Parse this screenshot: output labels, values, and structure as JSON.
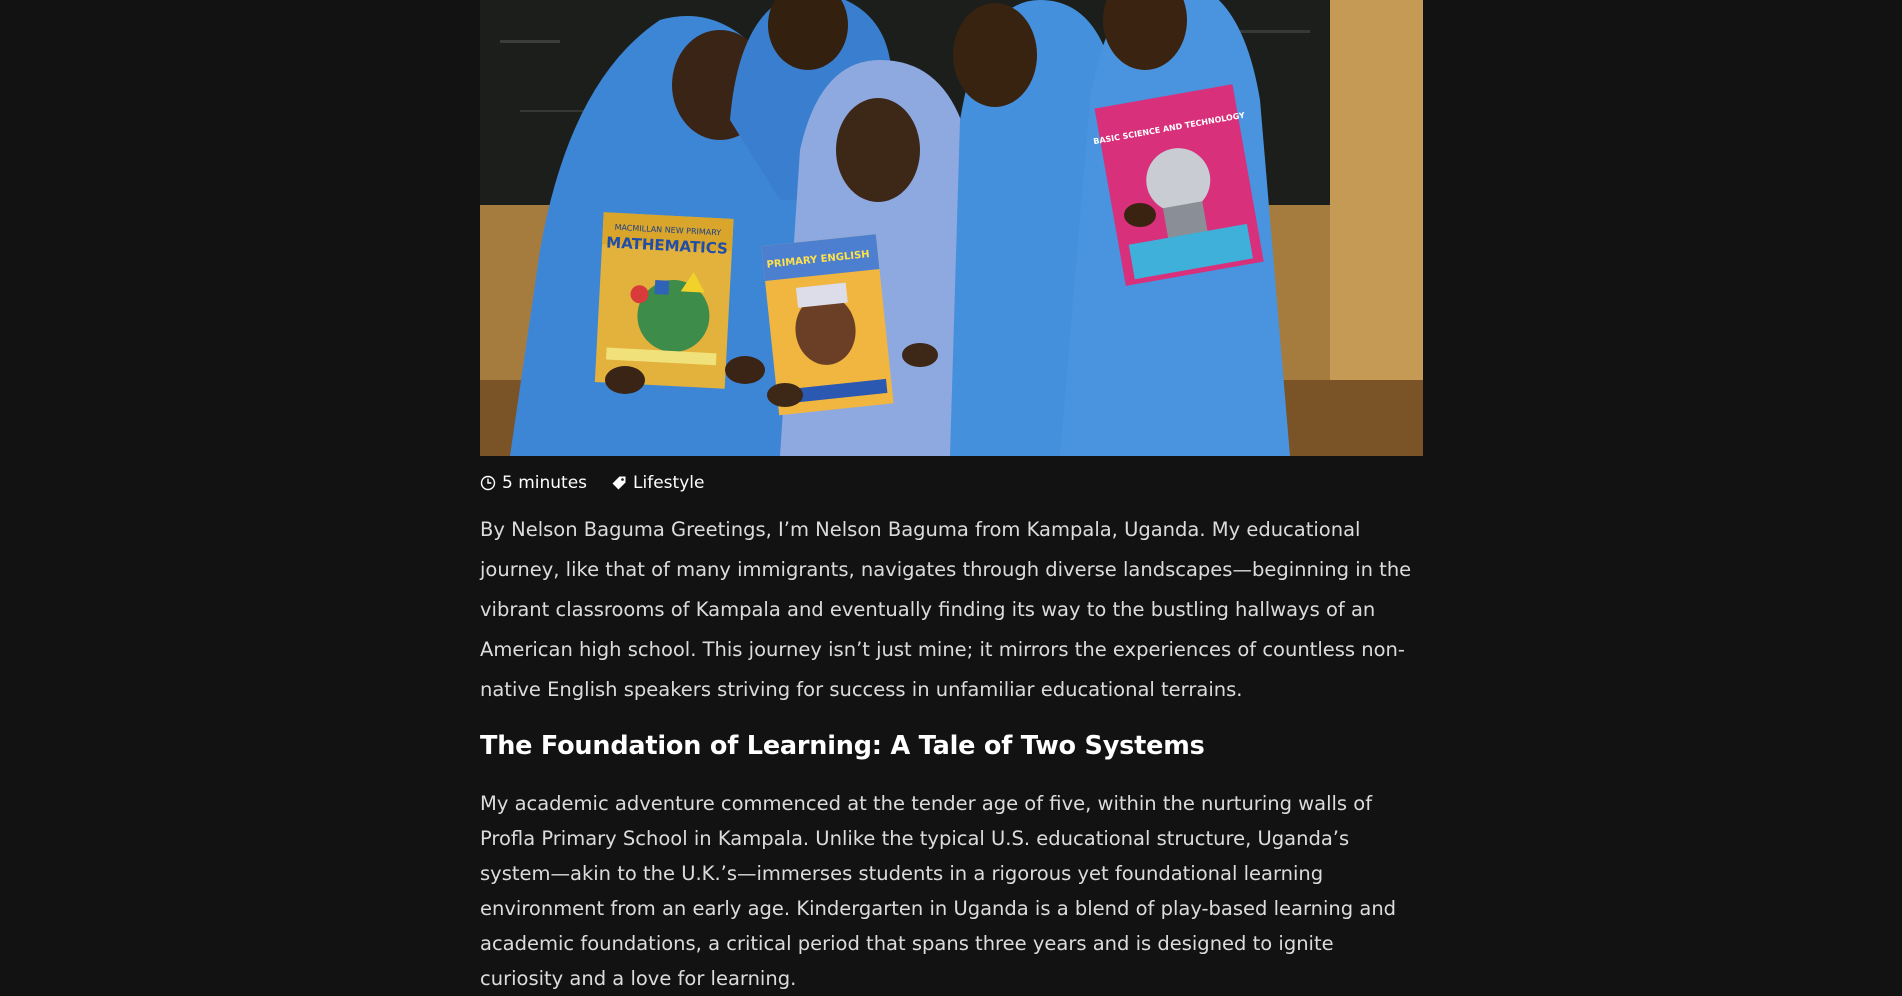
{
  "hero": {
    "book_titles": [
      "MACMILLAN NEW PRIMARY",
      "MATHEMATICS",
      "PRIMARY ENGLISH",
      "BASIC SCIENCE AND TECHNOLOGY"
    ]
  },
  "meta": {
    "read_time": "5 minutes",
    "category": "Lifestyle",
    "read_time_icon": "clock-icon",
    "category_icon": "tag-icon"
  },
  "article": {
    "intro": "By Nelson Baguma Greetings, I’m Nelson Baguma from Kampala, Uganda. My educational journey, like that of many immigrants, navigates through diverse landscapes—beginning in the vibrant classrooms of Kampala and eventually finding its way to the bustling hallways of an American high school. This journey isn’t just mine; it mirrors the experiences of countless non-native English speakers striving for success in unfamiliar educational terrains.",
    "heading": "The Foundation of Learning: A Tale of Two Systems",
    "paragraph": "My academic adventure commenced at the tender age of five, within the nurturing walls of Profla Primary School in Kampala. Unlike the typical U.S. educational structure, Uganda’s system—akin to the U.K.’s—immerses students in a rigorous yet foundational learning environment from an early age. Kindergarten in Uganda is a blend of play-based learning and academic foundations, a critical period that spans three years and is designed to ignite curiosity and a love for learning."
  },
  "colors": {
    "background": "#121212",
    "text": "#dcdcdc",
    "heading": "#ffffff",
    "uniform_blue": "#3d86d6"
  }
}
